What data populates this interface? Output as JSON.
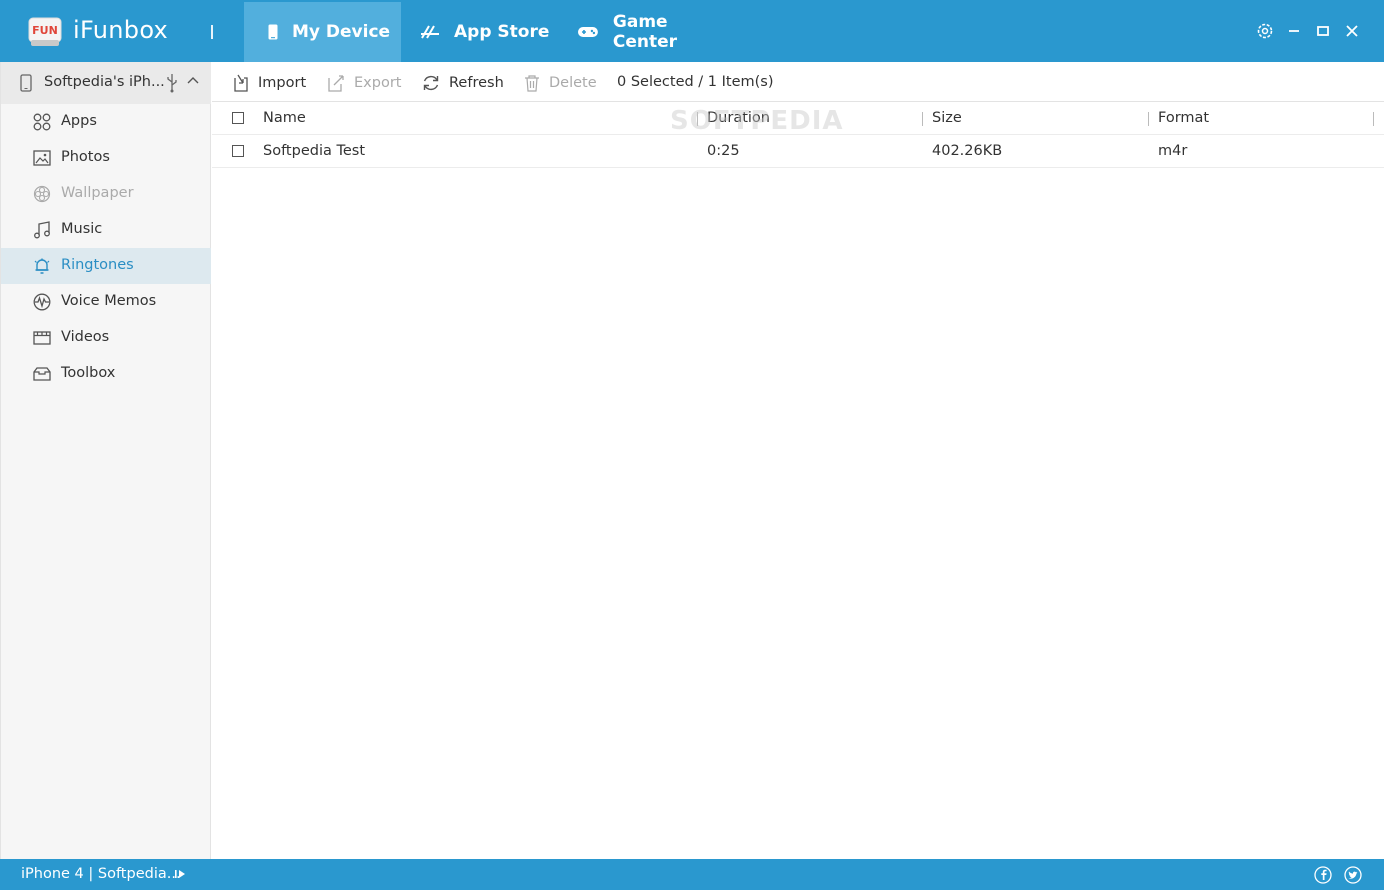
{
  "app": {
    "title": "iFunbox",
    "logo_text": "FUN",
    "colors": {
      "accent": "#2a98cf",
      "active_tab": "#52afdd",
      "active_nav_text": "#2a8ec4"
    }
  },
  "tabs": [
    {
      "label": "My Device",
      "icon": "phone-icon",
      "active": true
    },
    {
      "label": "App Store",
      "icon": "app-store-icon",
      "active": false
    },
    {
      "label": "Game Center",
      "icon": "gamepad-icon",
      "active": false
    }
  ],
  "window_controls": [
    "settings-icon",
    "minimize-icon",
    "maximize-icon",
    "close-icon"
  ],
  "device": {
    "name": "Softpedia's iPh...",
    "connection_icon": "usb-icon"
  },
  "sidebar": {
    "items": [
      {
        "label": "Apps",
        "icon": "apps-grid-icon",
        "state": "normal"
      },
      {
        "label": "Photos",
        "icon": "photo-icon",
        "state": "normal"
      },
      {
        "label": "Wallpaper",
        "icon": "flower-icon",
        "state": "disabled"
      },
      {
        "label": "Music",
        "icon": "music-note-icon",
        "state": "normal"
      },
      {
        "label": "Ringtones",
        "icon": "bell-icon",
        "state": "active"
      },
      {
        "label": "Voice Memos",
        "icon": "waveform-icon",
        "state": "normal"
      },
      {
        "label": "Videos",
        "icon": "film-icon",
        "state": "normal"
      },
      {
        "label": "Toolbox",
        "icon": "toolbox-icon",
        "state": "normal"
      }
    ]
  },
  "toolbar": {
    "import_label": "Import",
    "export_label": "Export",
    "refresh_label": "Refresh",
    "delete_label": "Delete",
    "selection_status": "0 Selected / 1 Item(s)"
  },
  "table": {
    "columns": [
      "Name",
      "Duration",
      "Size",
      "Format"
    ],
    "rows": [
      {
        "name": "Softpedia Test",
        "duration": "0:25",
        "size": "402.26KB",
        "format": "m4r"
      }
    ]
  },
  "watermark": "SOFTPEDIA",
  "statusbar": {
    "text": "iPhone 4 | Softpedia...",
    "social": [
      "facebook-icon",
      "twitter-icon"
    ]
  }
}
